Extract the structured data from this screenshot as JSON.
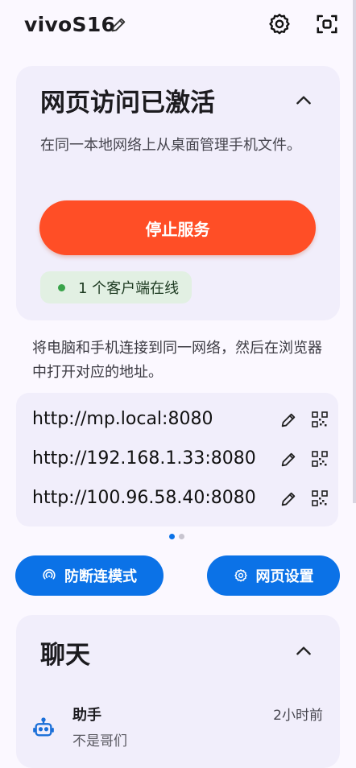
{
  "header": {
    "device_name": "vivoS16",
    "icons": {
      "edit": "pencil-icon",
      "settings": "gear-icon",
      "scan": "scan-icon"
    }
  },
  "web_access": {
    "title": "网页访问已激活",
    "description": "在同一本地网络上从桌面管理手机文件。",
    "stop_label": "停止服务",
    "online_status": "1 个客户端在线",
    "colors": {
      "stop_button": "#ff4e26",
      "online_dot": "#39a34a"
    }
  },
  "hint": "将电脑和手机连接到同一网络，然后在浏览器中打开对应的地址。",
  "urls": [
    "http://mp.local:8080",
    "http://192.168.1.33:8080",
    "http://100.96.58.40:8080"
  ],
  "pager": {
    "current": 1,
    "total": 2
  },
  "actions": {
    "anti_disconnect_label": "防断连模式",
    "web_settings_label": "网页设置",
    "accent": "#0b72e7"
  },
  "chat": {
    "title": "聊天",
    "items": [
      {
        "name": "助手",
        "time": "2小时前",
        "preview": "不是哥们",
        "icon": "robot-icon"
      }
    ]
  }
}
